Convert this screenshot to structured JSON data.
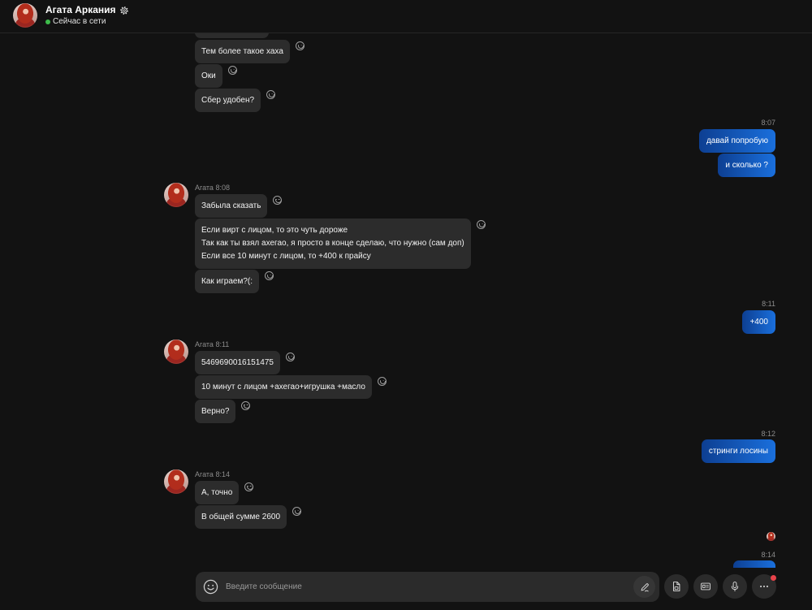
{
  "header": {
    "contact_name": "Агата Аркания",
    "status": "Сейчас в сети"
  },
  "chat": [
    {
      "incoming": [
        "Тем более такое хаха",
        "Оки",
        "Сбер удобен?"
      ]
    },
    {
      "time": "8:07",
      "outgoing": [
        "давай попробую",
        "и сколько ?"
      ]
    },
    {
      "sender": "Агата",
      "time": "8:08",
      "incoming": [
        "Забыла сказать",
        "Если вирт с лицом, то это чуть дороже\nТак как ты взял ахегао, я просто в конце сделаю, что нужно (сам доп)\nЕсли все 10 минут с лицом, то +400 к прайсу",
        "Как играем?(:"
      ]
    },
    {
      "time": "8:11",
      "outgoing": [
        "+400"
      ]
    },
    {
      "sender": "Агата",
      "time": "8:11",
      "incoming": [
        "5469690016151475",
        "10 минут с лицом +ахегао+игрушка +масло",
        "Верно?"
      ]
    },
    {
      "time": "8:12",
      "outgoing": [
        "стринги лосины"
      ]
    },
    {
      "sender": "Агата",
      "time": "8:14",
      "incoming": [
        "А, точно",
        "В общей сумме 2600"
      ]
    },
    {
      "time": "8:14",
      "outgoing": []
    }
  ],
  "composer": {
    "placeholder": "Введите сообщение"
  },
  "icons": {
    "contact_avatar": "contact-avatar",
    "settings": "gear-icon",
    "reaction": "smiley-icon",
    "read_receipt": "read-receipt-avatar",
    "composer_emoji": "emoji-icon",
    "highlight": "pen-icon",
    "send_file": "file-icon",
    "send_contact": "contact-card-icon",
    "voice_message": "microphone-icon",
    "more": "more-icon"
  },
  "colors": {
    "background": "#121212",
    "incoming_bubble": "#2c2c2c",
    "outgoing_bubble_from": "#0d3f92",
    "outgoing_bubble_to": "#1a6fdc",
    "muted_text": "#8c8c8c",
    "online_indicator": "#3dbb4a",
    "notification_badge": "#e8434a",
    "control_background": "#2b2b2b"
  }
}
